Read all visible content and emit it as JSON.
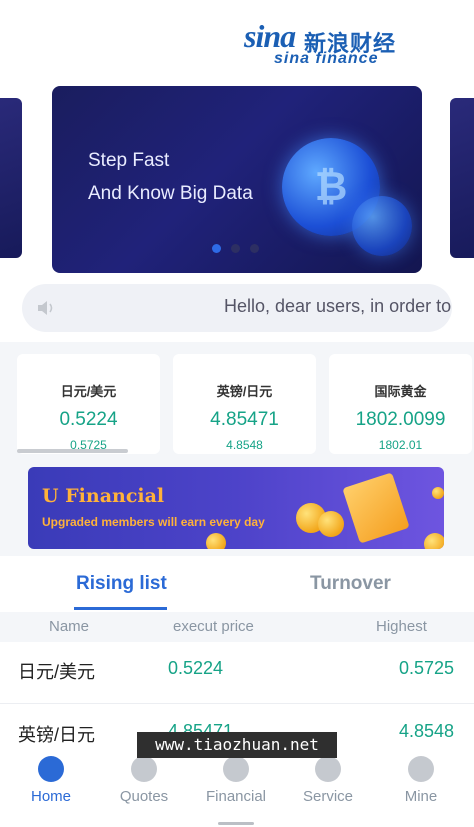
{
  "header": {
    "logo_word": "sina",
    "logo_cn": "新浪财经",
    "logo_en": "sina finance"
  },
  "banner": {
    "line1": "Step Fast",
    "line2": "And Know Big Data",
    "coin_symbol": "₿"
  },
  "notice": {
    "text": "Hello, dear users, in order to"
  },
  "quotes": [
    {
      "name": "日元/美元",
      "price": "0.5224",
      "sub": "0.5725"
    },
    {
      "name": "英镑/日元",
      "price": "4.85471",
      "sub": "4.8548"
    },
    {
      "name": "国际黄金",
      "price": "1802.0099",
      "sub": "1802.01"
    }
  ],
  "promo": {
    "title": "U Financial",
    "subtitle": "Upgraded members will earn every day"
  },
  "tabs": {
    "active": "Rising list",
    "inactive": "Turnover"
  },
  "table": {
    "headers": {
      "name": "Name",
      "price": "execut price",
      "high": "Highest"
    },
    "rows": [
      {
        "name": "日元/美元",
        "price": "0.5224",
        "high": "0.5725"
      },
      {
        "name": "英镑/日元",
        "price": "4.85471",
        "high": "4.8548"
      }
    ]
  },
  "watermark": "www.tiaozhuan.net",
  "nav": [
    {
      "label": "Home",
      "icon": "home-icon"
    },
    {
      "label": "Quotes",
      "icon": "trend-icon"
    },
    {
      "label": "Financial",
      "icon": "financial-icon"
    },
    {
      "label": "Service",
      "icon": "headset-icon"
    },
    {
      "label": "Mine",
      "icon": "user-icon"
    }
  ],
  "colors": {
    "brand": "#1b5fb4",
    "accent": "#2b6ad6",
    "up": "#16a387",
    "muted": "#8a96a3"
  }
}
